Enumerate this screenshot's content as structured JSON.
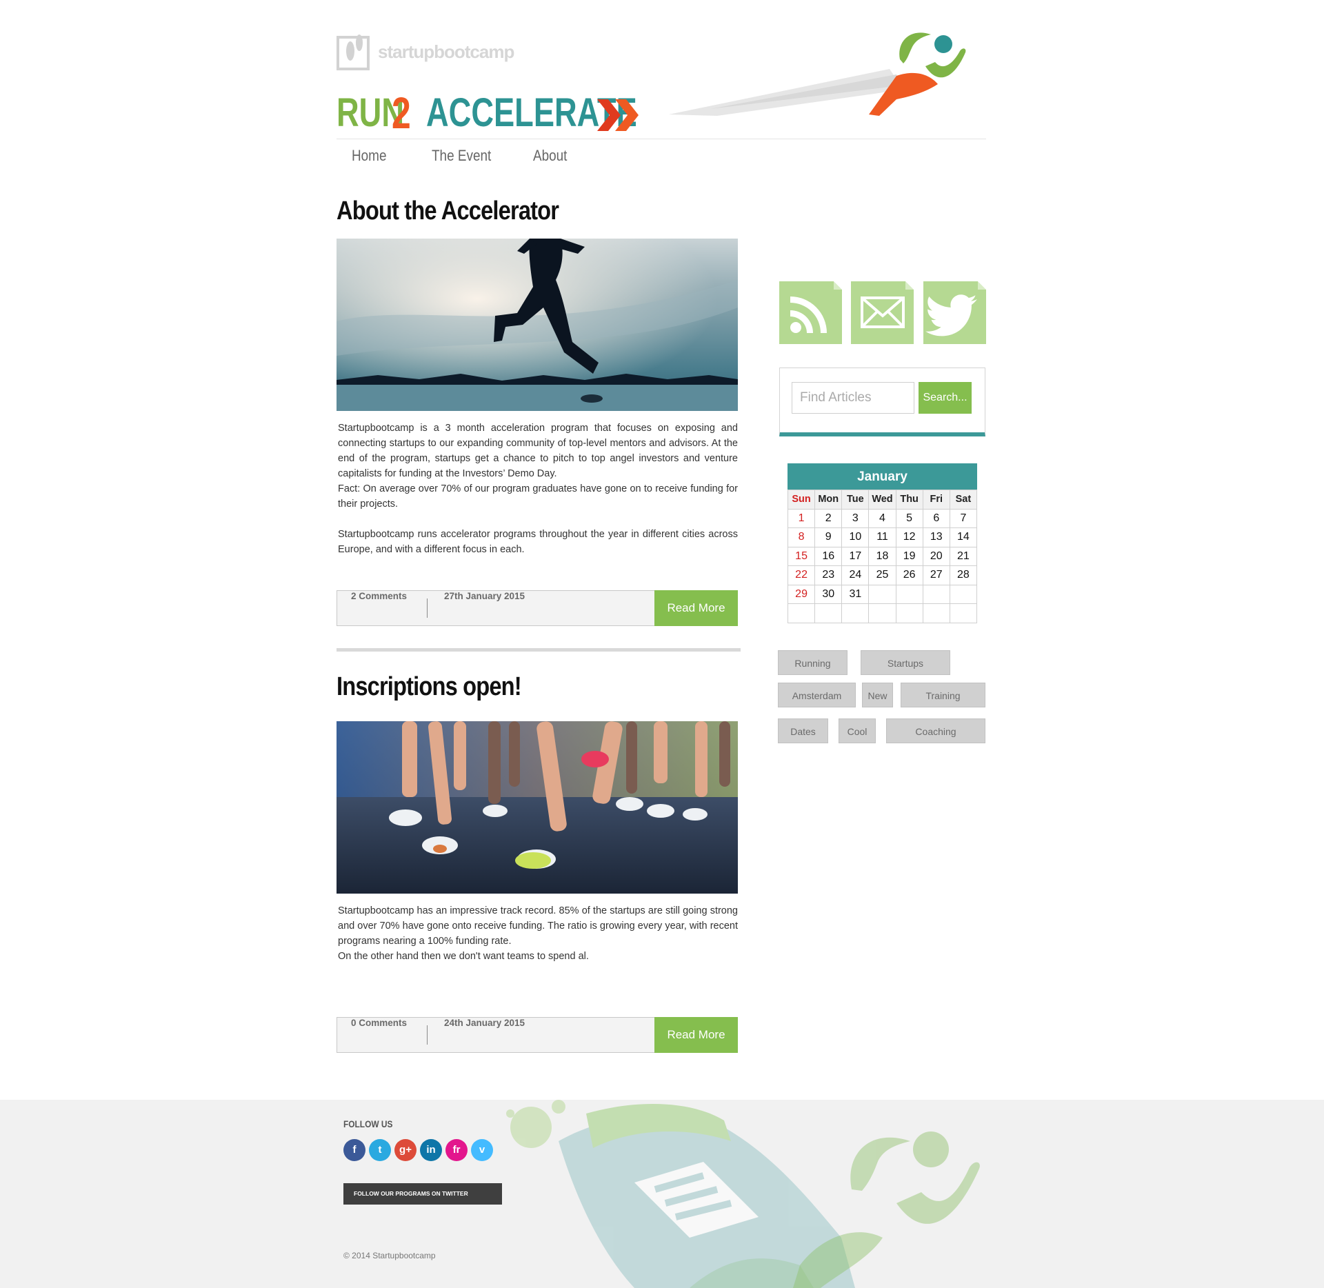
{
  "header": {
    "sbc_logo_text": "startupbootcamp",
    "brand_run": "RUN",
    "brand_two": "2",
    "brand_accelerate": "ACCELERATE"
  },
  "nav": {
    "items": [
      "Home",
      "The Event",
      "About"
    ]
  },
  "posts": [
    {
      "title": "About the Accelerator",
      "paragraphs": [
        "Startupbootcamp is a 3 month acceleration program that focuses on exposing and connecting startups to our expanding community of top-level mentors and advisors. At the end of the program, startups get a chance to pitch to top angel investors and venture capitalists for funding at the Investors’ Demo Day.",
        "Fact: On average over 70% of our program graduates have gone on to receive funding for their projects.",
        "Startupbootcamp runs accelerator programs throughout the year in different cities across Europe, and with a different focus in each."
      ],
      "comments": "2 Comments",
      "date": "27th January 2015",
      "read_more": "Read More"
    },
    {
      "title": "Inscriptions open!",
      "paragraphs": [
        "Startupbootcamp has an impressive track record. 85% of the startups are still going strong and over 70% have gone onto receive funding. The ratio is growing every year, with recent programs nearing a 100% funding rate.",
        "On the other hand then we don't want teams to spend al."
      ],
      "comments": "0 Comments",
      "date": "24th January 2015",
      "read_more": "Read More"
    }
  ],
  "sidebar": {
    "social_icons": [
      "rss-icon",
      "mail-icon",
      "twitter-icon"
    ],
    "search": {
      "placeholder": "Find Articles",
      "value": "",
      "button": "Search..."
    },
    "calendar": {
      "month": "January",
      "weekdays": [
        "Sun",
        "Mon",
        "Tue",
        "Wed",
        "Thu",
        "Fri",
        "Sat"
      ],
      "weeks": [
        [
          "1",
          "2",
          "3",
          "4",
          "5",
          "6",
          "7"
        ],
        [
          "8",
          "9",
          "10",
          "11",
          "12",
          "13",
          "14"
        ],
        [
          "15",
          "16",
          "17",
          "18",
          "19",
          "20",
          "21"
        ],
        [
          "22",
          "23",
          "24",
          "25",
          "26",
          "27",
          "28"
        ],
        [
          "29",
          "30",
          "31",
          "",
          "",
          "",
          ""
        ],
        [
          "",
          "",
          "",
          "",
          "",
          "",
          ""
        ]
      ]
    },
    "tags": [
      "Running",
      "Startups",
      "Amsterdam",
      "New",
      "Training",
      "Dates",
      "Cool",
      "Coaching"
    ]
  },
  "footer": {
    "follow_title": "FOLLOW US",
    "social": [
      {
        "icon": "facebook-icon",
        "glyph": "f",
        "color": "#3b5998"
      },
      {
        "icon": "twitter-icon",
        "glyph": "t",
        "color": "#2aa9e0"
      },
      {
        "icon": "google-plus-icon",
        "glyph": "g+",
        "color": "#dd4b39"
      },
      {
        "icon": "linkedin-icon",
        "glyph": "in",
        "color": "#0e76a8"
      },
      {
        "icon": "friendfeed-icon",
        "glyph": "fr",
        "color": "#e3168d"
      },
      {
        "icon": "vimeo-icon",
        "glyph": "v",
        "color": "#44bbff"
      }
    ],
    "twitter_follow": "FOLLOW OUR PROGRAMS ON TWITTER",
    "copyright": "© 2014 Startupbootcamp"
  },
  "colors": {
    "green": "#85be4e",
    "teal": "#3c9998",
    "orange": "#ef5a22"
  }
}
